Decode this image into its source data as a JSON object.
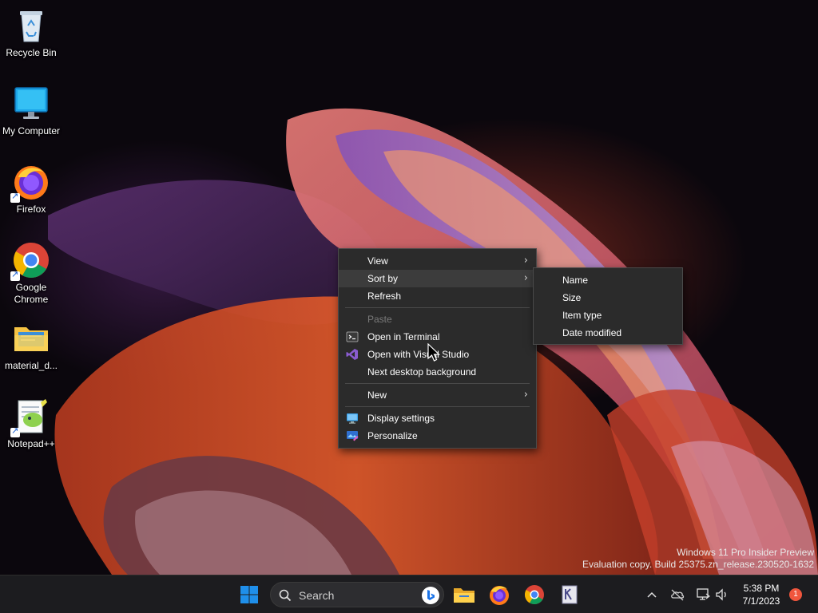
{
  "desktop": {
    "icons": [
      {
        "label": "Recycle Bin"
      },
      {
        "label": "My Computer"
      },
      {
        "label": "Firefox"
      },
      {
        "label": "Google Chrome"
      },
      {
        "label": "material_d..."
      },
      {
        "label": "Notepad++"
      }
    ]
  },
  "context_menu": {
    "items": [
      {
        "label": "View",
        "has_submenu": true
      },
      {
        "label": "Sort by",
        "has_submenu": true
      },
      {
        "label": "Refresh"
      },
      {
        "label": "Paste",
        "disabled": true
      },
      {
        "label": "Open in Terminal",
        "icon": "terminal-icon"
      },
      {
        "label": "Open with Visual Studio",
        "icon": "visual-studio-icon"
      },
      {
        "label": "Next desktop background"
      },
      {
        "label": "New",
        "has_submenu": true
      },
      {
        "label": "Display settings",
        "icon": "display-icon"
      },
      {
        "label": "Personalize",
        "icon": "personalize-icon"
      }
    ],
    "chevron": "›"
  },
  "sort_submenu": {
    "items": [
      {
        "label": "Name"
      },
      {
        "label": "Size"
      },
      {
        "label": "Item type"
      },
      {
        "label": "Date modified"
      }
    ]
  },
  "watermark": {
    "line1": "Windows 11 Pro Insider Preview",
    "line2": "Evaluation copy. Build 25375.zn_release.230520-1632"
  },
  "taskbar": {
    "search_placeholder": "Search",
    "time": "5:38 PM",
    "date": "7/1/2023",
    "notification_count": "1"
  },
  "colors": {
    "menu_bg": "#2b2b2b",
    "taskbar_bg": "#1c1c1f",
    "windows_blue": "#1f8fea",
    "badge": "#f0563d"
  }
}
